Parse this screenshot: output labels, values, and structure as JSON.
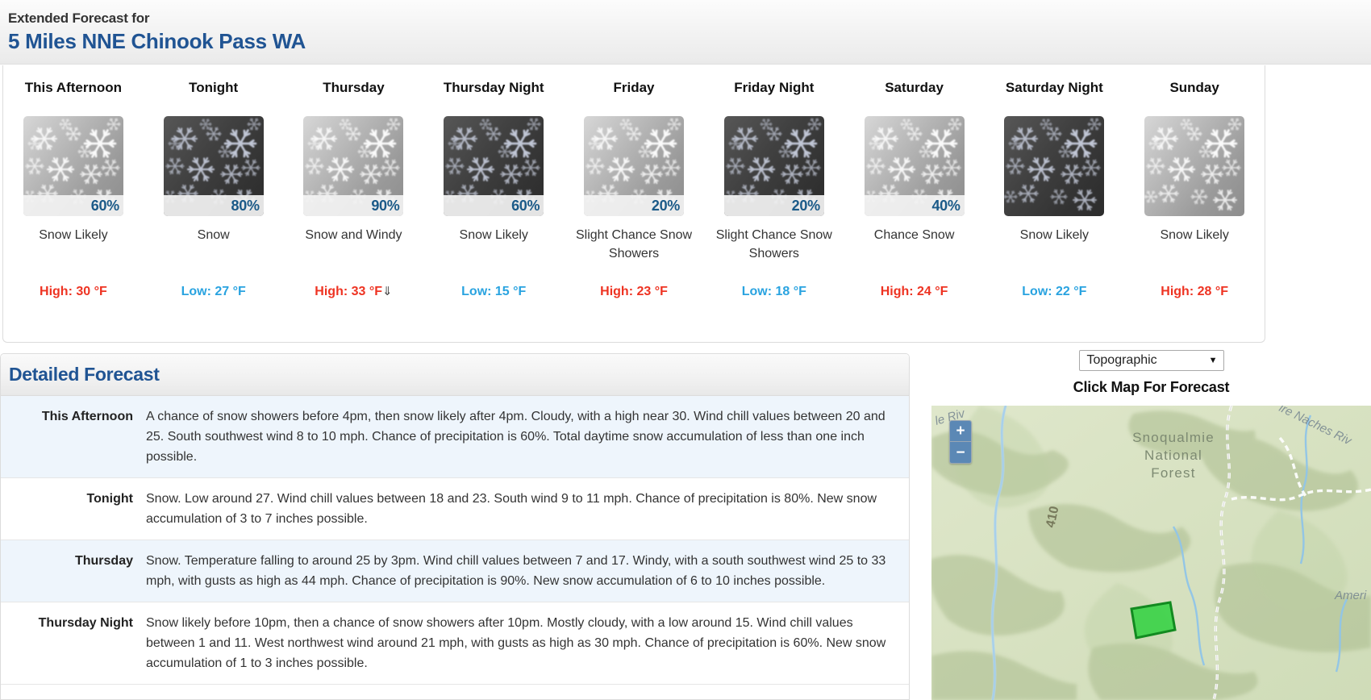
{
  "header": {
    "kicker": "Extended Forecast for",
    "location": "5 Miles NNE Chinook Pass WA"
  },
  "forecast_cards": [
    {
      "title": "This Afternoon",
      "period": "day",
      "pop": "60%",
      "condition": "Snow Likely",
      "temp_label": "High: 30 °F",
      "temp_kind": "high",
      "trend": ""
    },
    {
      "title": "Tonight",
      "period": "night",
      "pop": "80%",
      "condition": "Snow",
      "temp_label": "Low: 27 °F",
      "temp_kind": "low",
      "trend": ""
    },
    {
      "title": "Thursday",
      "period": "day",
      "pop": "90%",
      "condition": "Snow and Windy",
      "temp_label": "High: 33 °F",
      "temp_kind": "high",
      "trend": "⇓"
    },
    {
      "title": "Thursday Night",
      "period": "night",
      "pop": "60%",
      "condition": "Snow Likely",
      "temp_label": "Low: 15 °F",
      "temp_kind": "low",
      "trend": ""
    },
    {
      "title": "Friday",
      "period": "day",
      "pop": "20%",
      "condition": "Slight Chance Snow Showers",
      "temp_label": "High: 23 °F",
      "temp_kind": "high",
      "trend": ""
    },
    {
      "title": "Friday Night",
      "period": "night",
      "pop": "20%",
      "condition": "Slight Chance Snow Showers",
      "temp_label": "Low: 18 °F",
      "temp_kind": "low",
      "trend": ""
    },
    {
      "title": "Saturday",
      "period": "day",
      "pop": "40%",
      "condition": "Chance Snow",
      "temp_label": "High: 24 °F",
      "temp_kind": "high",
      "trend": ""
    },
    {
      "title": "Saturday Night",
      "period": "night",
      "pop": "",
      "condition": "Snow Likely",
      "temp_label": "Low: 22 °F",
      "temp_kind": "low",
      "trend": ""
    },
    {
      "title": "Sunday",
      "period": "day",
      "pop": "",
      "condition": "Snow Likely",
      "temp_label": "High: 28 °F",
      "temp_kind": "high",
      "trend": ""
    }
  ],
  "detailed_forecast": {
    "heading": "Detailed Forecast",
    "rows": [
      {
        "label": "This Afternoon",
        "text": "A chance of snow showers before 4pm, then snow likely after 4pm. Cloudy, with a high near 30. Wind chill values between 20 and 25. South southwest wind 8 to 10 mph. Chance of precipitation is 60%. Total daytime snow accumulation of less than one inch possible."
      },
      {
        "label": "Tonight",
        "text": "Snow. Low around 27. Wind chill values between 18 and 23. South wind 9 to 11 mph. Chance of precipitation is 80%. New snow accumulation of 3 to 7 inches possible."
      },
      {
        "label": "Thursday",
        "text": "Snow. Temperature falling to around 25 by 3pm. Wind chill values between 7 and 17. Windy, with a south southwest wind 25 to 33 mph, with gusts as high as 44 mph. Chance of precipitation is 90%. New snow accumulation of 6 to 10 inches possible."
      },
      {
        "label": "Thursday Night",
        "text": "Snow likely before 10pm, then a chance of snow showers after 10pm. Mostly cloudy, with a low around 15. Wind chill values between 1 and 11. West northwest wind around 21 mph, with gusts as high as 30 mph. Chance of precipitation is 60%. New snow accumulation of 1 to 3 inches possible."
      }
    ]
  },
  "map": {
    "layer_selected": "Topographic",
    "chevron": "▼",
    "click_label": "Click Map For Forecast",
    "zoom_in": "+",
    "zoom_out": "−",
    "labels": {
      "forest": "Snoqualmie National Forest",
      "forest_line1": "Snoqualmie",
      "forest_line2": "National",
      "forest_line3": "Forest",
      "highway": "410",
      "river_top_left": "le Riv",
      "river_top_right": "ire Naches Riv",
      "place_right": "Ameri"
    }
  },
  "colors": {
    "link_blue": "#205493",
    "high_red": "#ee3322",
    "low_blue": "#29a3e0",
    "pop_blue": "#1b5a88",
    "row_alt": "#eef5fc",
    "map_green": "#22b14c"
  }
}
